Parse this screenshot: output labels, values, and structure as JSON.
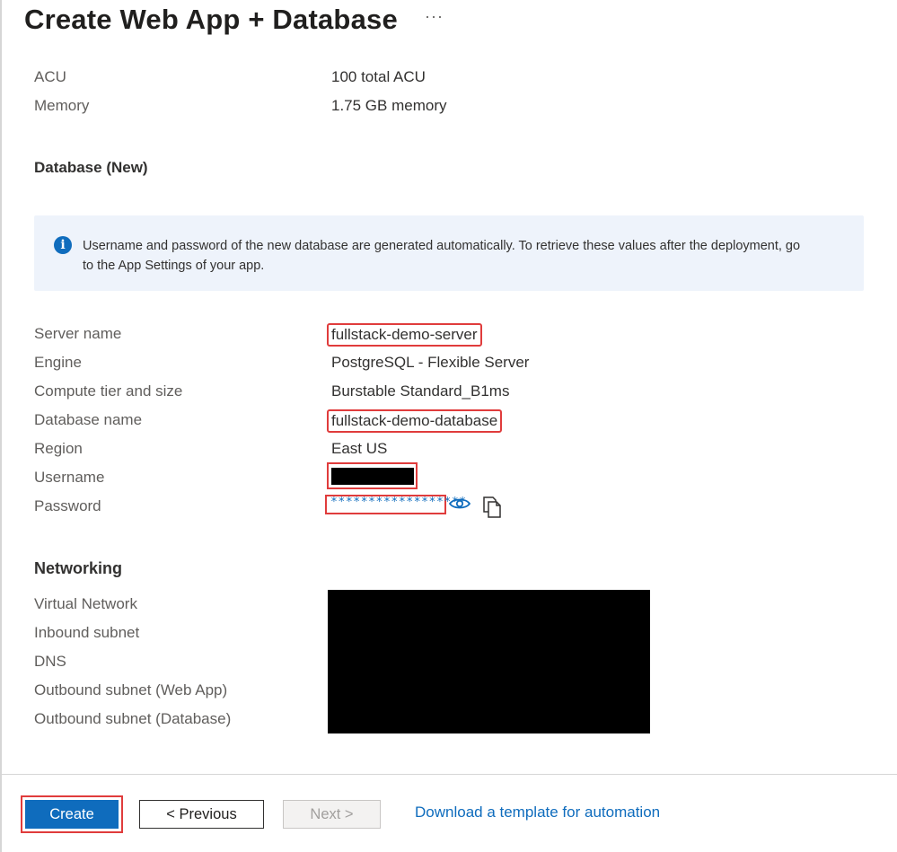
{
  "page": {
    "title": "Create Web App + Database",
    "more_label": "···"
  },
  "app_plan": {
    "rows": [
      {
        "label": "ACU",
        "value": "100 total ACU"
      },
      {
        "label": "Memory",
        "value": "1.75 GB memory"
      }
    ]
  },
  "database": {
    "section_title": "Database (New)",
    "info": "Username and password of the new database are generated automatically. To retrieve these values after the deployment, go to the App Settings of your app.",
    "server_name_label": "Server name",
    "server_name": "fullstack-demo-server",
    "engine_label": "Engine",
    "engine": "PostgreSQL - Flexible Server",
    "compute_label": "Compute tier and size",
    "compute": "Burstable Standard_B1ms",
    "db_name_label": "Database name",
    "db_name": "fullstack-demo-database",
    "region_label": "Region",
    "region": "East US",
    "username_label": "Username",
    "password_label": "Password",
    "password_masked": "******************"
  },
  "networking": {
    "section_title": "Networking",
    "labels": [
      "Virtual Network",
      "Inbound subnet",
      "DNS",
      "Outbound subnet (Web App)",
      "Outbound subnet (Database)"
    ]
  },
  "footer": {
    "create_label": "Create",
    "previous_label": "< Previous",
    "next_label": "Next >",
    "download_label": "Download a template for automation"
  },
  "colors": {
    "accent": "#0f6cbd",
    "highlight": "#e03c3c"
  }
}
